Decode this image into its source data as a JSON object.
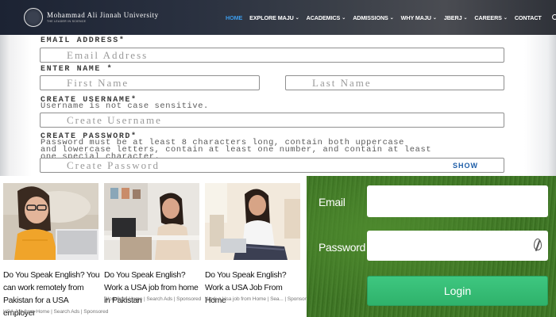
{
  "navbar": {
    "logo_name": "Mohammad Ali Jinnah University",
    "logo_tagline": "THE LEADER IN SCIENCE",
    "logo_seal": "MAJU",
    "menu": [
      {
        "label": "HOME",
        "active": true,
        "dropdown": false
      },
      {
        "label": "EXPLORE MAJU",
        "active": false,
        "dropdown": true
      },
      {
        "label": "ACADEMICS",
        "active": false,
        "dropdown": true
      },
      {
        "label": "ADMISSIONS",
        "active": false,
        "dropdown": true
      },
      {
        "label": "WHY MAJU",
        "active": false,
        "dropdown": true
      },
      {
        "label": "JBERJ",
        "active": false,
        "dropdown": true
      },
      {
        "label": "CAREERS",
        "active": false,
        "dropdown": true
      },
      {
        "label": "CONTACT",
        "active": false,
        "dropdown": false
      }
    ],
    "active_color": "#3d9be9"
  },
  "signup_form": {
    "email_label": "EMAIL ADDRESS*",
    "email_placeholder": "Email Address",
    "name_label": "ENTER NAME *",
    "first_name_placeholder": "First Name",
    "last_name_placeholder": "Last Name",
    "username_label": "CREATE USERNAME*",
    "username_note": "Username is not case sensitive.",
    "username_placeholder": "Create Username",
    "password_label": "CREATE PASSWORD*",
    "password_note_lines": [
      "Password must be at least 8 characters long, contain both uppercase",
      "and lowercase letters, contain at least one number, and contain at least",
      "one special character."
    ],
    "password_placeholder": "Create Password",
    "show_label": "SHOW"
  },
  "ads": [
    {
      "title": "Do You Speak English? You can work remotely from Pakistan for a USA employer",
      "source": "USA Job from Home | Search Ads | Sponsored"
    },
    {
      "title": "Do You Speak English? Work a USA job from home in Pakistan",
      "source": "Work from Home | Search Ads | Sponsored"
    },
    {
      "title": "Do You Speak English? Work a USA Job From Home",
      "source": "Work a Usa job from Home | Sea... | Sponsored"
    }
  ],
  "login": {
    "email_label": "Email",
    "password_label": "Password",
    "button_label": "Login",
    "button_color": "#35bb73",
    "background_color": "#3f7526"
  }
}
